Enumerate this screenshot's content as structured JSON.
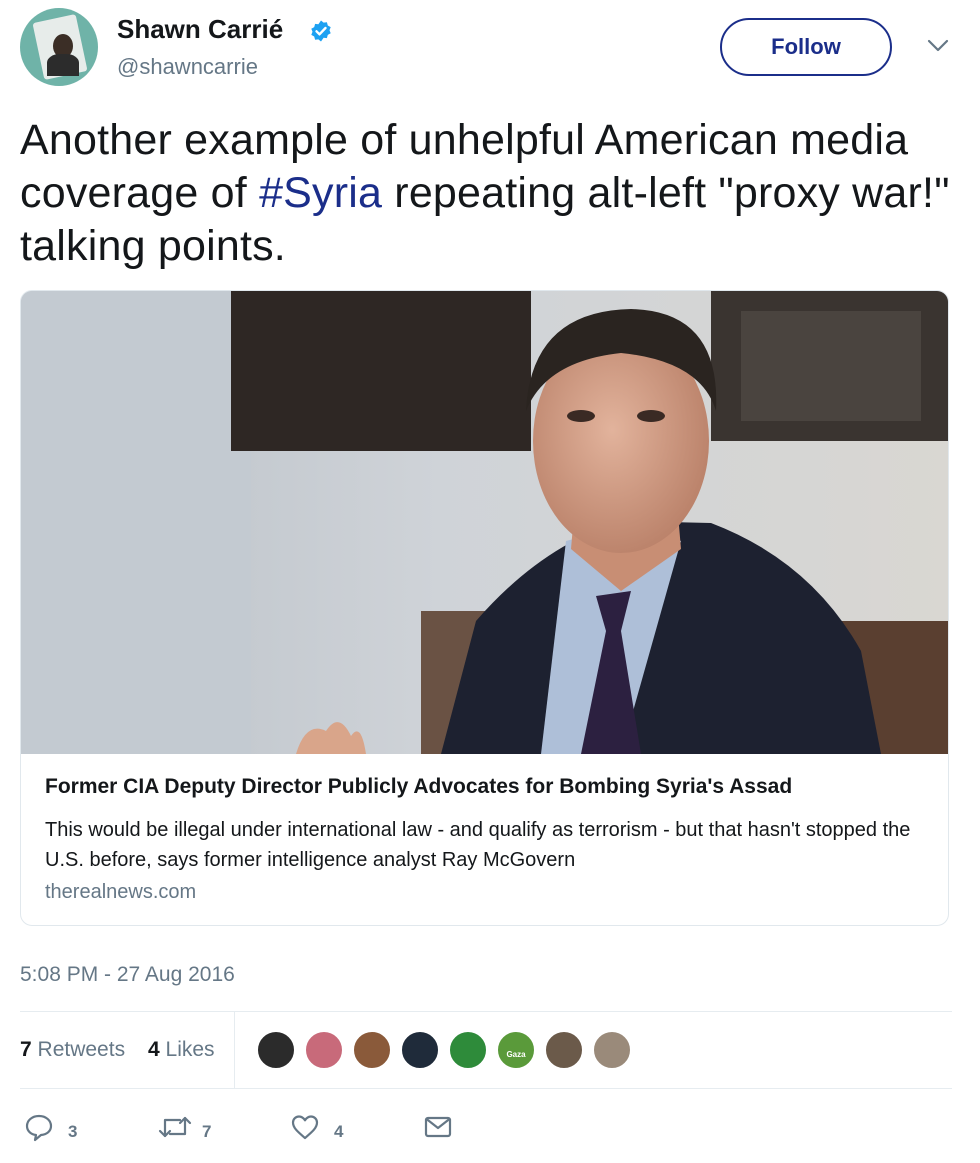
{
  "author": {
    "name": "Shawn Carrié",
    "handle": "@shawncarrie"
  },
  "follow_label": "Follow",
  "tweet": {
    "text_before": "Another example of unhelpful American media coverage of ",
    "hashtag": "#Syria",
    "text_after": " repeating alt-left \"proxy war!\" talking points."
  },
  "card": {
    "title": "Former CIA Deputy Director Publicly Advocates for Bombing Syria's Assad",
    "description": "This would be illegal under international law - and qualify as terrorism - but that hasn't stopped the U.S. before, says former intelligence analyst Ray McGovern",
    "domain": "therealnews.com"
  },
  "timestamp": "5:08 PM - 27 Aug 2016",
  "stats": {
    "retweets_count": "7",
    "retweets_label": "Retweets",
    "likes_count": "4",
    "likes_label": "Likes"
  },
  "liker_avatars": [
    {
      "name": "liker-avatar-1",
      "color": "#2b2b2b"
    },
    {
      "name": "liker-avatar-2",
      "color": "#c86a7a"
    },
    {
      "name": "liker-avatar-3",
      "color": "#8a5a3a"
    },
    {
      "name": "liker-avatar-4",
      "color": "#1f2b3a"
    },
    {
      "name": "liker-avatar-5",
      "color": "#2e8b3a"
    },
    {
      "name": "liker-avatar-6",
      "color": "#5a9a3a",
      "label": "Gaza"
    },
    {
      "name": "liker-avatar-7",
      "color": "#6b5a4a"
    },
    {
      "name": "liker-avatar-8",
      "color": "#9a8a7a"
    }
  ],
  "actions": {
    "reply_count": "3",
    "retweet_count": "7",
    "like_count": "4"
  },
  "colors": {
    "link_blue": "#1b2e8a",
    "verified_blue": "#1da1f2",
    "muted_gray": "#657786"
  }
}
